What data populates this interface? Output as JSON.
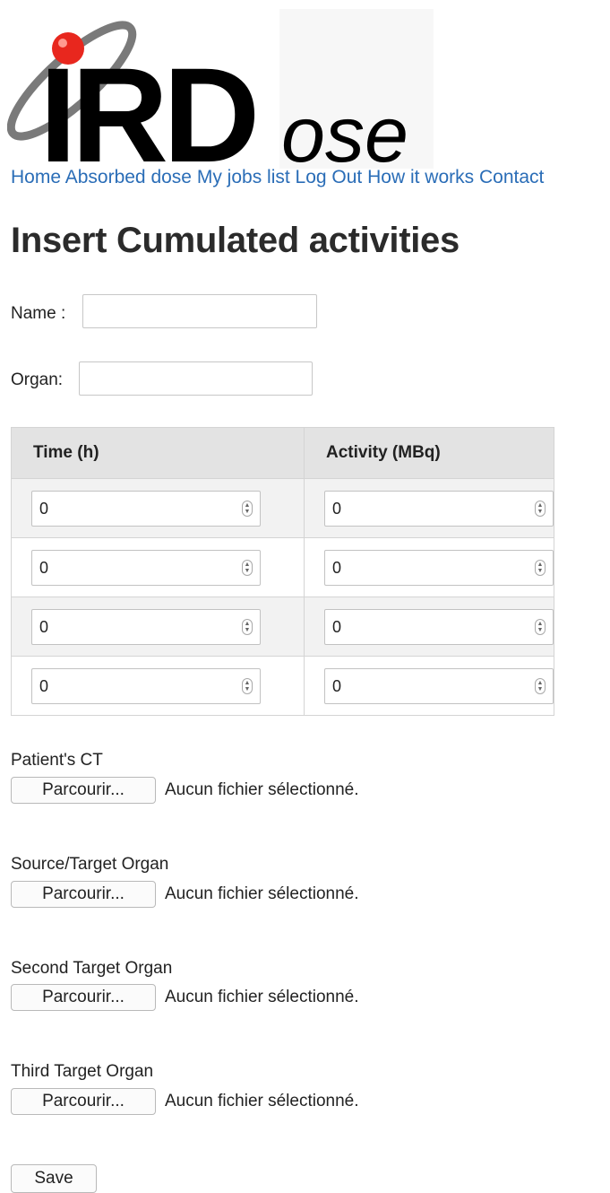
{
  "logo": {
    "text_main": "IRD",
    "text_suffix": "ose",
    "colors": {
      "ring": "#7a7a7a",
      "dot": "#e8271e",
      "letters": "#000000"
    }
  },
  "nav": {
    "items": [
      {
        "label": "Home"
      },
      {
        "label": "Absorbed dose"
      },
      {
        "label": "My jobs list"
      },
      {
        "label": "Log Out"
      },
      {
        "label": "How it works"
      },
      {
        "label": "Contact"
      }
    ]
  },
  "page_title": "Insert Cumulated activities",
  "form": {
    "name_label": "Name :",
    "name_value": "",
    "organ_label": "Organ:",
    "organ_value": "",
    "table": {
      "headers": [
        "Time (h)",
        "Activity (MBq)"
      ],
      "rows": [
        {
          "time": "0",
          "activity": "0"
        },
        {
          "time": "0",
          "activity": "0"
        },
        {
          "time": "0",
          "activity": "0"
        },
        {
          "time": "0",
          "activity": "0"
        }
      ]
    },
    "files": [
      {
        "label": "Patient's CT",
        "button": "Parcourir...",
        "status": "Aucun fichier sélectionné."
      },
      {
        "label": "Source/Target Organ",
        "button": "Parcourir...",
        "status": "Aucun fichier sélectionné."
      },
      {
        "label": "Second Target Organ",
        "button": "Parcourir...",
        "status": "Aucun fichier sélectionné."
      },
      {
        "label": "Third Target Organ",
        "button": "Parcourir...",
        "status": "Aucun fichier sélectionné."
      }
    ],
    "save_label": "Save"
  },
  "icons": {
    "spinner": "up-down-spinner-icon"
  },
  "colors": {
    "link": "#2a6db7",
    "header_bg": "#e3e3e3",
    "row_alt_bg": "#f2f2f2"
  }
}
